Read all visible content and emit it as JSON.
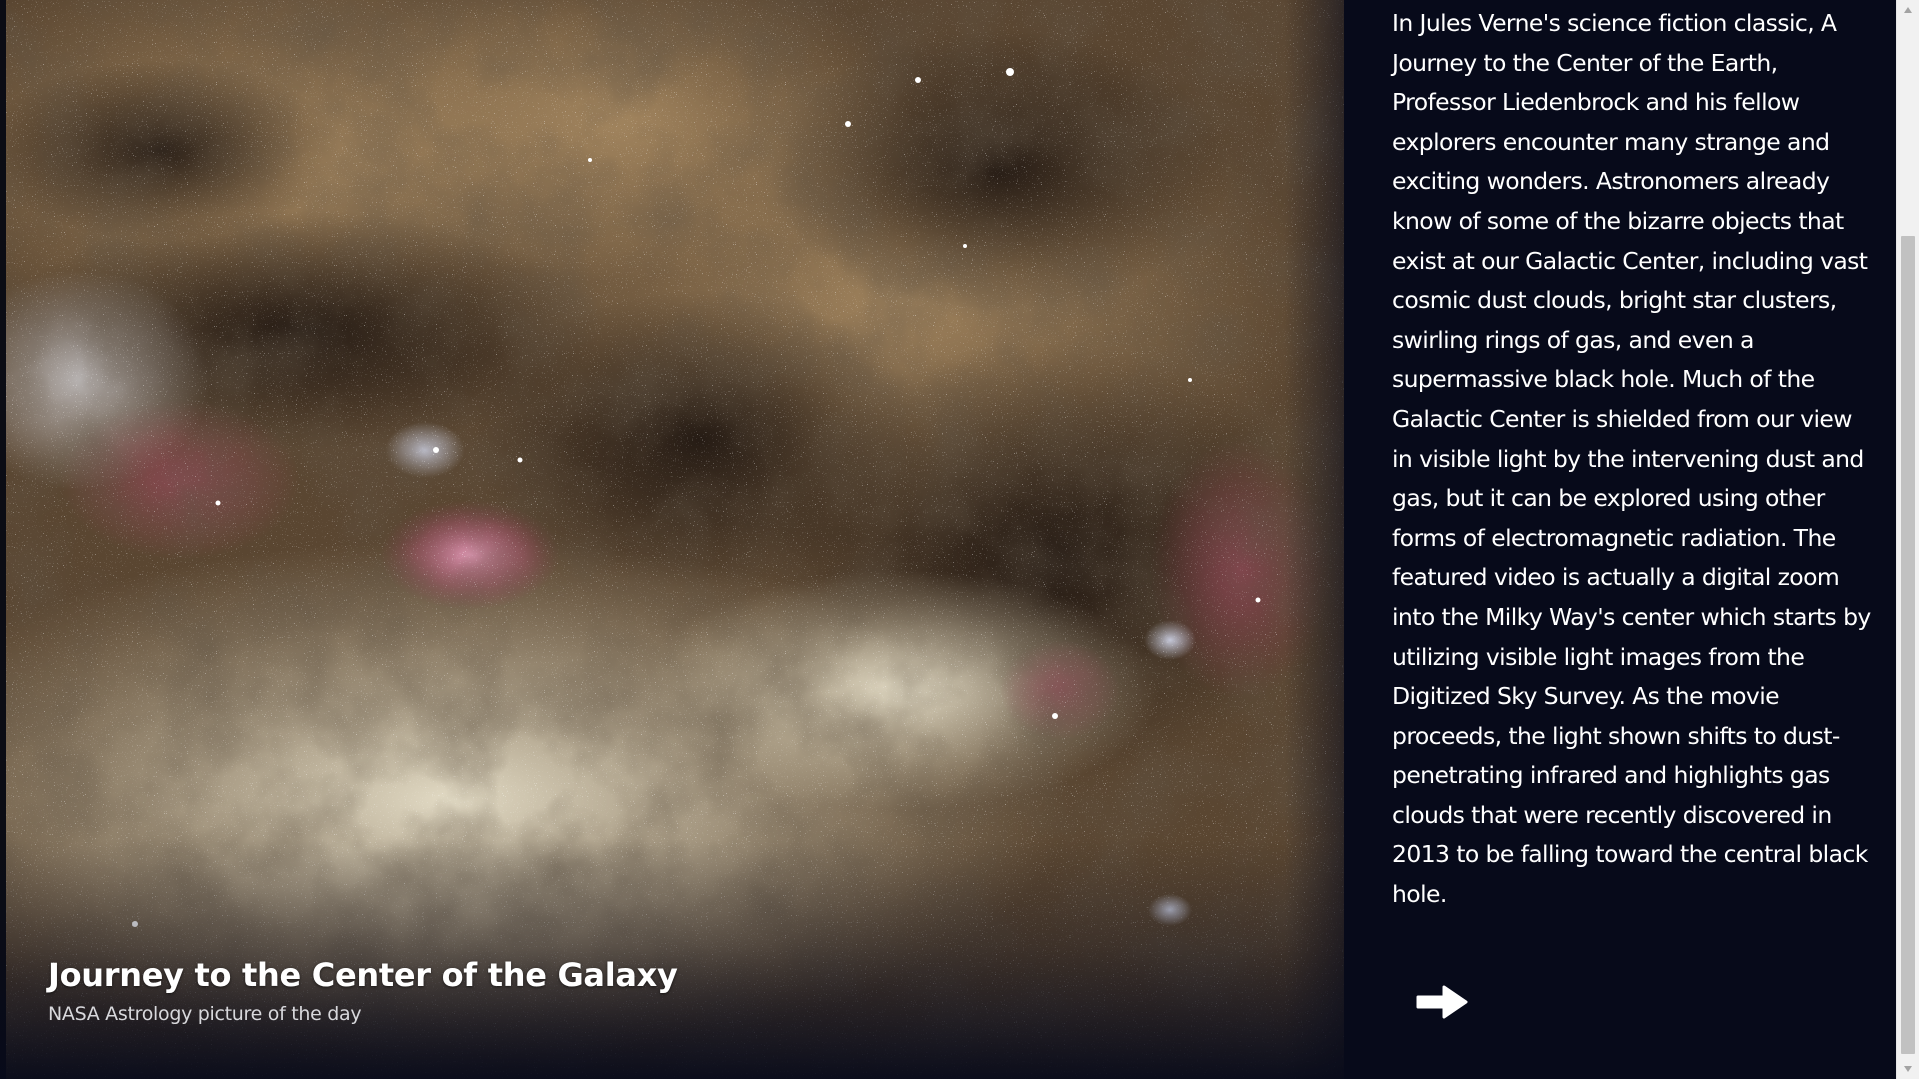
{
  "apod": {
    "title": "Journey to the Center of the Galaxy",
    "subtitle": "NASA Astrology picture of the day",
    "description": "In Jules Verne's science fiction classic, A Journey to the Center of the Earth, Professor Liedenbrock and his fellow explorers encounter many strange and exciting wonders. Astronomers already know of some of the bizarre objects that exist at our Galactic Center, including vast cosmic dust clouds, bright star clusters, swirling rings of gas, and even a supermassive black hole. Much of the Galactic Center is shielded from our view in visible light by the intervening dust and gas, but it can be explored using other forms of electromagnetic radiation. The featured video is actually a digital zoom into the Milky Way's center which starts by utilizing visible light images from the Digitized Sky Survey. As the movie proceeds, the light shown shifts to dust-penetrating infrared and highlights gas clouds that were recently discovered in 2013 to be falling toward the central black hole."
  },
  "navigation": {
    "next_icon": "arrow-right-icon"
  },
  "scrollbar": {
    "up_icon": "scroll-up-arrow-icon",
    "down_icon": "scroll-down-arrow-icon"
  },
  "colors": {
    "panel_background": "#070a1a",
    "text": "#ffffff",
    "subtitle_text": "#d8d8dc",
    "scrollbar_track": "#f1f1f1",
    "scrollbar_thumb": "#c1c1c1"
  }
}
